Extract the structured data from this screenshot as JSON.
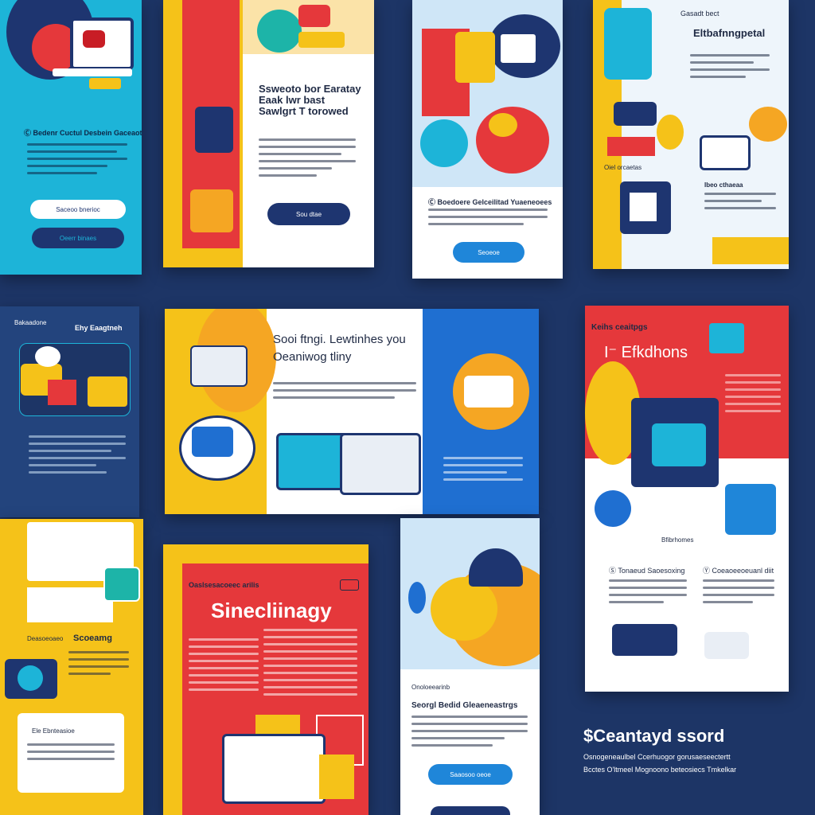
{
  "colors": {
    "background": "#1d3566",
    "yellow": "#f5c219",
    "red": "#e5383b",
    "blue": "#1f6fd1",
    "cyan": "#1db4d8",
    "navy": "#1e3570",
    "white": "#ffffff"
  },
  "cards": {
    "c1": {
      "heading": "Ⓒ Bedenr Cuctul Desbein Gaceaot",
      "button_primary": "Saceoo bnerioc",
      "button_secondary": "Oeerr binaes"
    },
    "c2": {
      "title_1": "Ssweoto bor Earatay",
      "title_2": "Eaak lwr bast",
      "title_3": "Sawlgrt T torowed",
      "button": "Sou dtae"
    },
    "c3": {
      "heading": "Ⓒ Boedoere Gelceilitad Yuaeneoees",
      "button": "Seoeoe"
    },
    "c4": {
      "label": "Gasadt bect",
      "title": "Eltbafnngpetal",
      "caption": "Oiel orcaetas",
      "sub": "Ibeo cthaeaa"
    },
    "c5": {
      "label": "Bakaadone",
      "title": "Ehy Eaagtneh"
    },
    "c6": {
      "title_1": "Sooi ftngi. Lewtinhes you",
      "title_2": "Oeaniwog tliny"
    },
    "c7": {
      "label": "Keihs ceaitpgs",
      "title": "I⁻ Efkdhons",
      "caption": "Bfibrhomes",
      "col1": "Ⓢ Tonaeud Saoesoxing",
      "col2": "Ⓨ Coeaoeeoeuanl diit"
    },
    "c8": {
      "label": "Deasoeoaeo",
      "title": "Scoeamg",
      "box": "Ele Ebnteasioe"
    },
    "c9": {
      "label": "Oaslsesacoeec arilis",
      "title": "Sinecliinagy"
    },
    "c10": {
      "label": "Onoloeearinb",
      "title": "Seorgl Bedid Gleaeneastrgs",
      "button": "Saaosoo oeoe"
    }
  },
  "caption": {
    "title": "$Ceantayd ssord",
    "line_1": "Osnogeneaulbel Ccerhuogor gorusaeseectertt",
    "line_2": "Bcctes O'ltmeel Mognoono beteosiecs Tmkelkar"
  },
  "icons": [
    "laptop-icon",
    "monitor-icon",
    "folder-icon",
    "globe-icon",
    "document-icon",
    "chart-icon",
    "camera-icon",
    "server-icon"
  ]
}
